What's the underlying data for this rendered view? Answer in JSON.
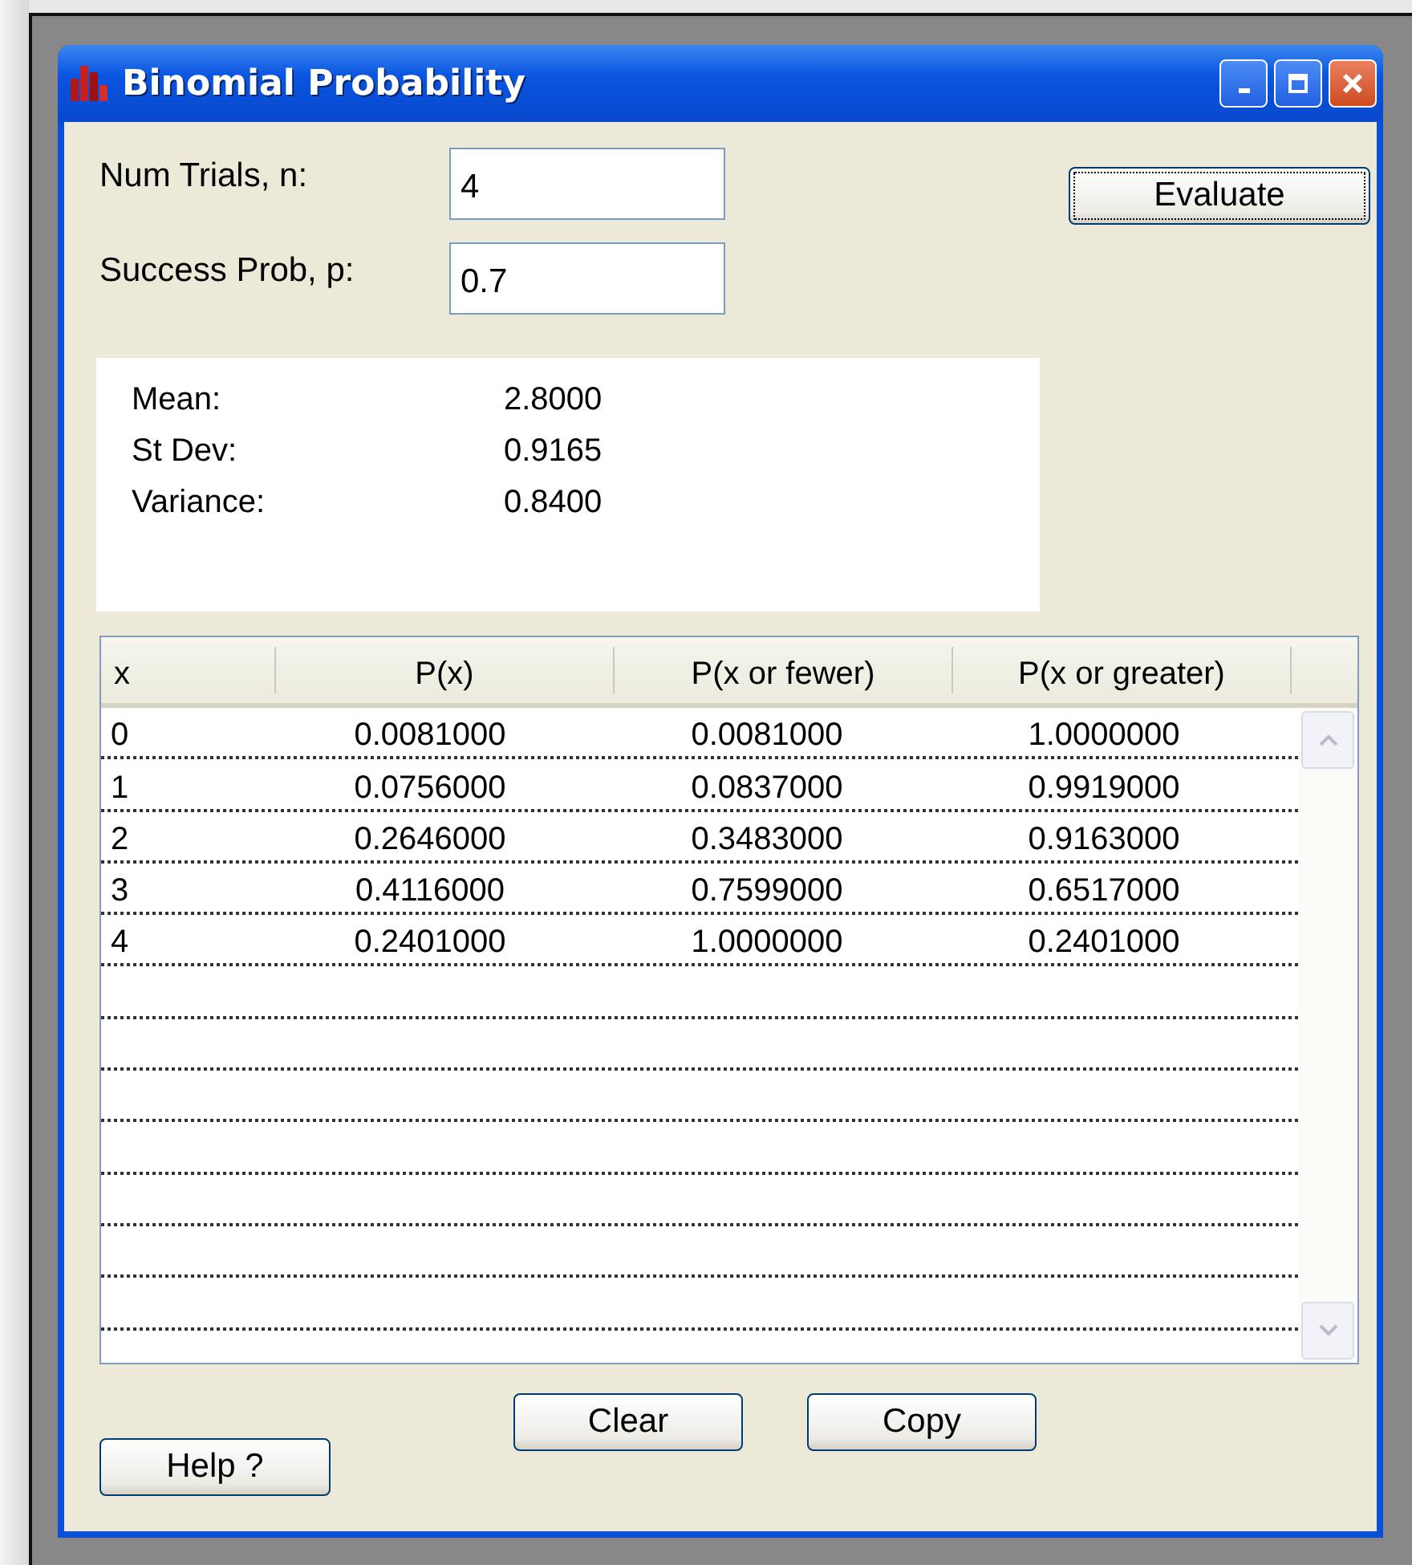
{
  "window": {
    "title": "Binomial Probability"
  },
  "inputs": [
    {
      "label": "Num Trials, n:",
      "value": "4"
    },
    {
      "label": "Success Prob, p:",
      "value": "0.7"
    }
  ],
  "evaluate_button": "Evaluate",
  "stats": [
    {
      "label": "Mean:",
      "value": "2.8000"
    },
    {
      "label": "St Dev:",
      "value": "0.9165"
    },
    {
      "label": "Variance:",
      "value": "0.8400"
    }
  ],
  "table": {
    "columns": [
      "x",
      "P(x)",
      "P(x or fewer)",
      "P(x or greater)"
    ],
    "rows": [
      [
        "0",
        "0.0081000",
        "0.0081000",
        "1.0000000"
      ],
      [
        "1",
        "0.0756000",
        "0.0837000",
        "0.9919000"
      ],
      [
        "2",
        "0.2646000",
        "0.3483000",
        "0.9163000"
      ],
      [
        "3",
        "0.4116000",
        "0.7599000",
        "0.6517000"
      ],
      [
        "4",
        "0.2401000",
        "1.0000000",
        "0.2401000"
      ]
    ]
  },
  "buttons": {
    "clear": "Clear",
    "copy": "Copy",
    "help": "Help ?"
  }
}
